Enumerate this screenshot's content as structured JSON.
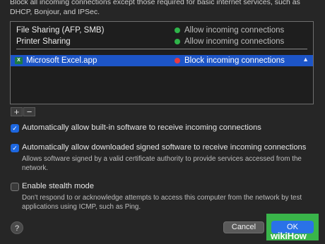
{
  "intro": {
    "line1": "Block all incoming connections except those required for basic internet services, such as",
    "line2": "DHCP, Bonjour, and IPSec."
  },
  "apps": [
    {
      "name": "File Sharing (AFP, SMB)",
      "status": "Allow incoming connections",
      "status_color": "#2fb44a"
    },
    {
      "name": "Printer Sharing",
      "status": "Allow incoming connections",
      "status_color": "#2fb44a"
    }
  ],
  "selected_app": {
    "name": "Microsoft Excel.app",
    "icon_letter": "X",
    "icon": "excel-app-icon",
    "status": "Block incoming connections",
    "status_color": "#e8393f"
  },
  "list_controls": {
    "add": "+",
    "remove": "−"
  },
  "options": [
    {
      "label": "Automatically allow built-in software to receive incoming connections",
      "checked": true,
      "desc": ""
    },
    {
      "label": "Automatically allow downloaded signed software to receive incoming connections",
      "checked": true,
      "desc": "Allows software signed by a valid certificate authority to provide services accessed from the network."
    },
    {
      "label": "Enable stealth mode",
      "checked": false,
      "desc": "Don't respond to or acknowledge attempts to access this computer from the network by test applications using ICMP, such as Ping."
    }
  ],
  "buttons": {
    "help": "?",
    "cancel": "Cancel",
    "ok": "OK"
  },
  "watermark": {
    "wiki": "wiki",
    "how": "How"
  },
  "colors": {
    "accent": "#1d55c7",
    "highlight": "#39b54a"
  }
}
